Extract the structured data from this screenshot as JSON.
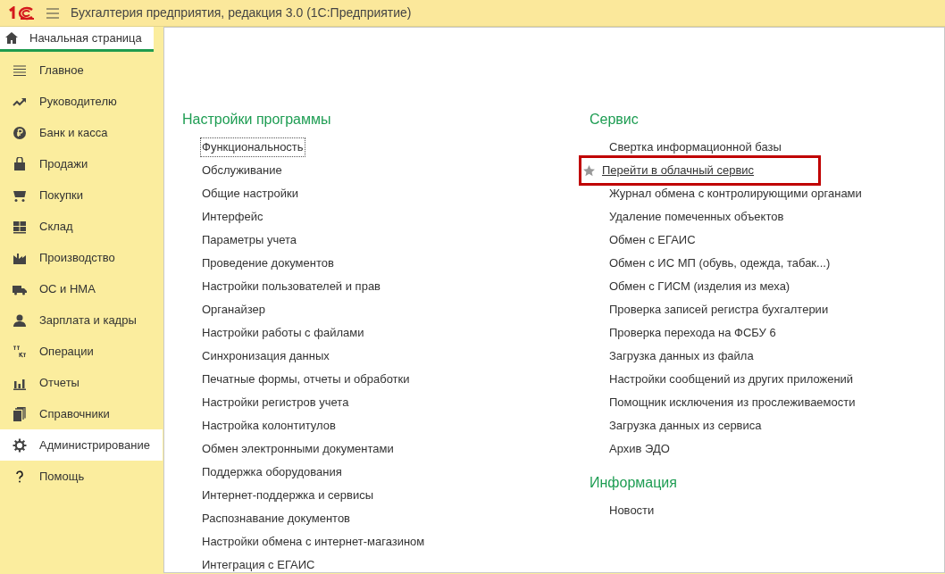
{
  "window": {
    "title": "Бухгалтерия предприятия, редакция 3.0  (1С:Предприятие)"
  },
  "home_tab": {
    "label": "Начальная страница",
    "selected": true
  },
  "sidebar": {
    "items": [
      {
        "label": "Главное",
        "selected": false
      },
      {
        "label": "Руководителю",
        "selected": false
      },
      {
        "label": "Банк и касса",
        "selected": false
      },
      {
        "label": "Продажи",
        "selected": false
      },
      {
        "label": "Покупки",
        "selected": false
      },
      {
        "label": "Склад",
        "selected": false
      },
      {
        "label": "Производство",
        "selected": false
      },
      {
        "label": "ОС и НМА",
        "selected": false
      },
      {
        "label": "Зарплата и кадры",
        "selected": false
      },
      {
        "label": "Операции",
        "selected": false
      },
      {
        "label": "Отчеты",
        "selected": false
      },
      {
        "label": "Справочники",
        "selected": false
      },
      {
        "label": "Администрирование",
        "selected": true
      },
      {
        "label": "Помощь",
        "selected": false
      }
    ]
  },
  "columns": [
    {
      "sections": [
        {
          "title": "Настройки программы",
          "links": [
            {
              "label": "Функциональность",
              "focused": true,
              "highlighted": false
            },
            {
              "label": "Обслуживание",
              "focused": false,
              "highlighted": false
            },
            {
              "label": "Общие настройки",
              "focused": false,
              "highlighted": false
            },
            {
              "label": "Интерфейс",
              "focused": false,
              "highlighted": false
            },
            {
              "label": "Параметры учета",
              "focused": false,
              "highlighted": false
            },
            {
              "label": "Проведение документов",
              "focused": false,
              "highlighted": false
            },
            {
              "label": "Настройки пользователей и прав",
              "focused": false,
              "highlighted": false
            },
            {
              "label": "Органайзер",
              "focused": false,
              "highlighted": false
            },
            {
              "label": "Настройки работы с файлами",
              "focused": false,
              "highlighted": false
            },
            {
              "label": "Синхронизация данных",
              "focused": false,
              "highlighted": false
            },
            {
              "label": "Печатные формы, отчеты и обработки",
              "focused": false,
              "highlighted": false
            },
            {
              "label": "Настройки регистров учета",
              "focused": false,
              "highlighted": false
            },
            {
              "label": "Настройка колонтитулов",
              "focused": false,
              "highlighted": false
            },
            {
              "label": "Обмен электронными документами",
              "focused": false,
              "highlighted": false
            },
            {
              "label": "Поддержка оборудования",
              "focused": false,
              "highlighted": false
            },
            {
              "label": "Интернет-поддержка и сервисы",
              "focused": false,
              "highlighted": false
            },
            {
              "label": "Распознавание документов",
              "focused": false,
              "highlighted": false
            },
            {
              "label": "Настройки обмена с интернет-магазином",
              "focused": false,
              "highlighted": false
            },
            {
              "label": "Интеграция с ЕГАИС",
              "focused": false,
              "highlighted": false
            }
          ]
        }
      ]
    },
    {
      "sections": [
        {
          "title": "Сервис",
          "links": [
            {
              "label": "Свертка информационной базы",
              "focused": false,
              "highlighted": false
            },
            {
              "label": "Перейти в облачный сервис",
              "focused": false,
              "highlighted": true
            },
            {
              "label": "Журнал обмена с контролирующими органами",
              "focused": false,
              "highlighted": false
            },
            {
              "label": "Удаление помеченных объектов",
              "focused": false,
              "highlighted": false
            },
            {
              "label": "Обмен с ЕГАИС",
              "focused": false,
              "highlighted": false
            },
            {
              "label": "Обмен с ИС МП (обувь, одежда, табак...)",
              "focused": false,
              "highlighted": false
            },
            {
              "label": "Обмен с ГИСМ (изделия из меха)",
              "focused": false,
              "highlighted": false
            },
            {
              "label": "Проверка записей регистра бухгалтерии",
              "focused": false,
              "highlighted": false
            },
            {
              "label": "Проверка перехода на ФСБУ 6",
              "focused": false,
              "highlighted": false
            },
            {
              "label": "Загрузка данных из файла",
              "focused": false,
              "highlighted": false
            },
            {
              "label": "Настройки сообщений из других приложений",
              "focused": false,
              "highlighted": false
            },
            {
              "label": "Помощник исключения из прослеживаемости",
              "focused": false,
              "highlighted": false
            },
            {
              "label": "Загрузка данных из сервиса",
              "focused": false,
              "highlighted": false
            },
            {
              "label": "Архив ЭДО",
              "focused": false,
              "highlighted": false
            }
          ]
        },
        {
          "title": "Информация",
          "links": [
            {
              "label": "Новости",
              "focused": false,
              "highlighted": false
            }
          ]
        }
      ]
    }
  ]
}
